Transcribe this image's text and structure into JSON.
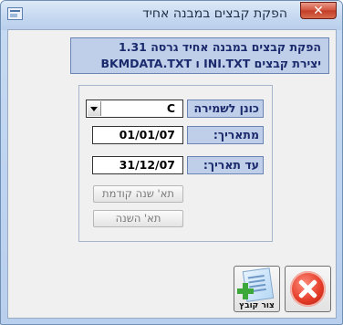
{
  "window": {
    "title": "הפקת קבצים במבנה אחיד"
  },
  "header": {
    "line1": "הפקת קבצים במבנה אחיד גרסה 1.31",
    "line2": "יצירת קבצים INI.TXT ו BKMDATA.TXT"
  },
  "form": {
    "drive_label": "כונן לשמירה",
    "drive_value": "C",
    "from_label": "מתאריך:",
    "from_value": "01/01/07",
    "to_label": "עד תאריך:",
    "to_value": "31/12/07"
  },
  "buttons": {
    "previous_year": "תא' שנה קודמת",
    "this_year": "תא' השנה",
    "create_file": "צור קובץ"
  },
  "icons": {
    "close": "close-x-icon",
    "exit": "exit-icon",
    "create": "create-file-icon",
    "dropdown": "chevron-down-icon"
  }
}
